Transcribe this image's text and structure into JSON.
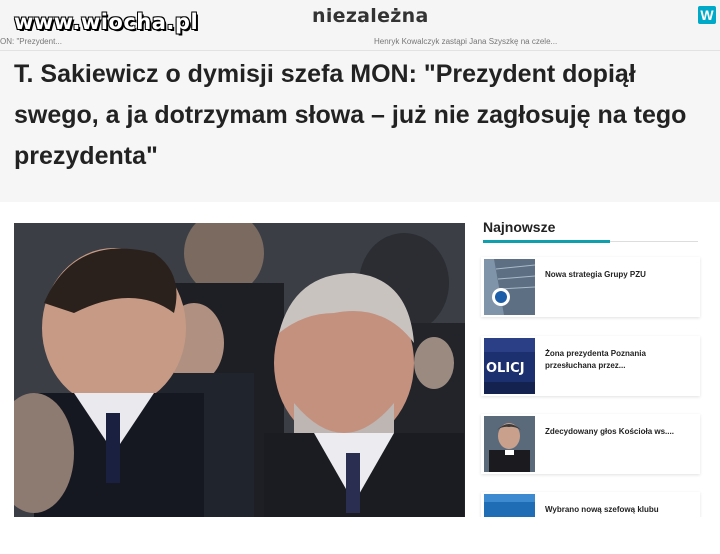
{
  "watermark": {
    "text": "www.wiocha.pl"
  },
  "header": {
    "logo": "niezależna",
    "ticker_left": "ON: \"Prezydent...",
    "ticker_right": "Henryk Kowalczyk zastąpi Jana Szyszkę na czele..."
  },
  "article": {
    "title": "T. Sakiewicz o dymisji szefa MON: \"Prezydent dopiął swego, a ja dotrzymam słowa – już nie zagłosuję na tego prezydenta\""
  },
  "sidebar": {
    "title": "Najnowsze",
    "items": [
      {
        "label": "Nowa strategia Grupy PZU",
        "thumb": "pzu-building"
      },
      {
        "label": "Żona prezydenta Poznania przesłuchana przez...",
        "thumb": "police-car"
      },
      {
        "label": "Zdecydowany głos Kościoła ws....",
        "thumb": "priest-portrait"
      },
      {
        "label": "Wybrano nową szefową klubu",
        "thumb": "blue-sign"
      }
    ]
  },
  "colors": {
    "accent": "#10a0ad",
    "corner_icon": "#00a9c8"
  },
  "icons": {
    "corner": "app-icon"
  },
  "corner_icon_glyph": "W"
}
